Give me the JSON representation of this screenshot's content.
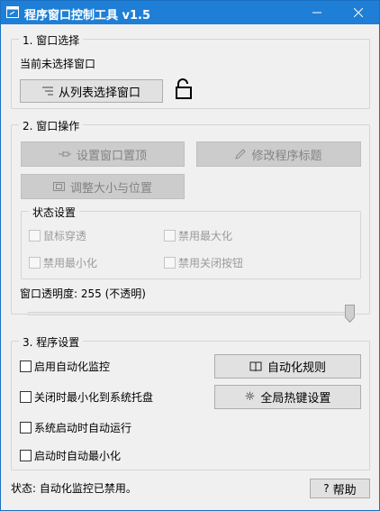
{
  "titlebar": {
    "title": "程序窗口控制工具 v1.5",
    "minimize_icon": "minimize-icon",
    "close_icon": "close-icon"
  },
  "section1": {
    "title": "1. 窗口选择",
    "status": "当前未选择窗口",
    "select_button": "从列表选择窗口",
    "select_icon": "list-icon",
    "lock_icon": "unlock-icon"
  },
  "section2": {
    "title": "2. 窗口操作",
    "topmost_button": "设置窗口置顶",
    "topmost_icon": "pin-icon",
    "rename_button": "修改程序标题",
    "rename_icon": "pencil-icon",
    "resize_button": "调整大小与位置",
    "resize_icon": "resize-icon",
    "state_group_title": "状态设置",
    "click_through": "鼠标穿透",
    "disable_maximize": "禁用最大化",
    "disable_minimize": "禁用最小化",
    "disable_close": "禁用关闭按钮",
    "opacity_label": "窗口透明度: 255 (不透明)",
    "opacity_value": 255,
    "opacity_max": 255
  },
  "section3": {
    "title": "3. 程序设置",
    "enable_monitor": "启用自动化监控",
    "min_to_tray": "关闭时最小化到系统托盘",
    "autostart": "系统启动时自动运行",
    "start_minimized": "启动时自动最小化",
    "rules_button": "自动化规则",
    "rules_icon": "book-icon",
    "hotkey_button": "全局热键设置",
    "hotkey_icon": "gear-icon"
  },
  "statusbar": {
    "status": "状态: 自动化监控已禁用。",
    "help_button": "帮助",
    "help_icon": "?"
  }
}
